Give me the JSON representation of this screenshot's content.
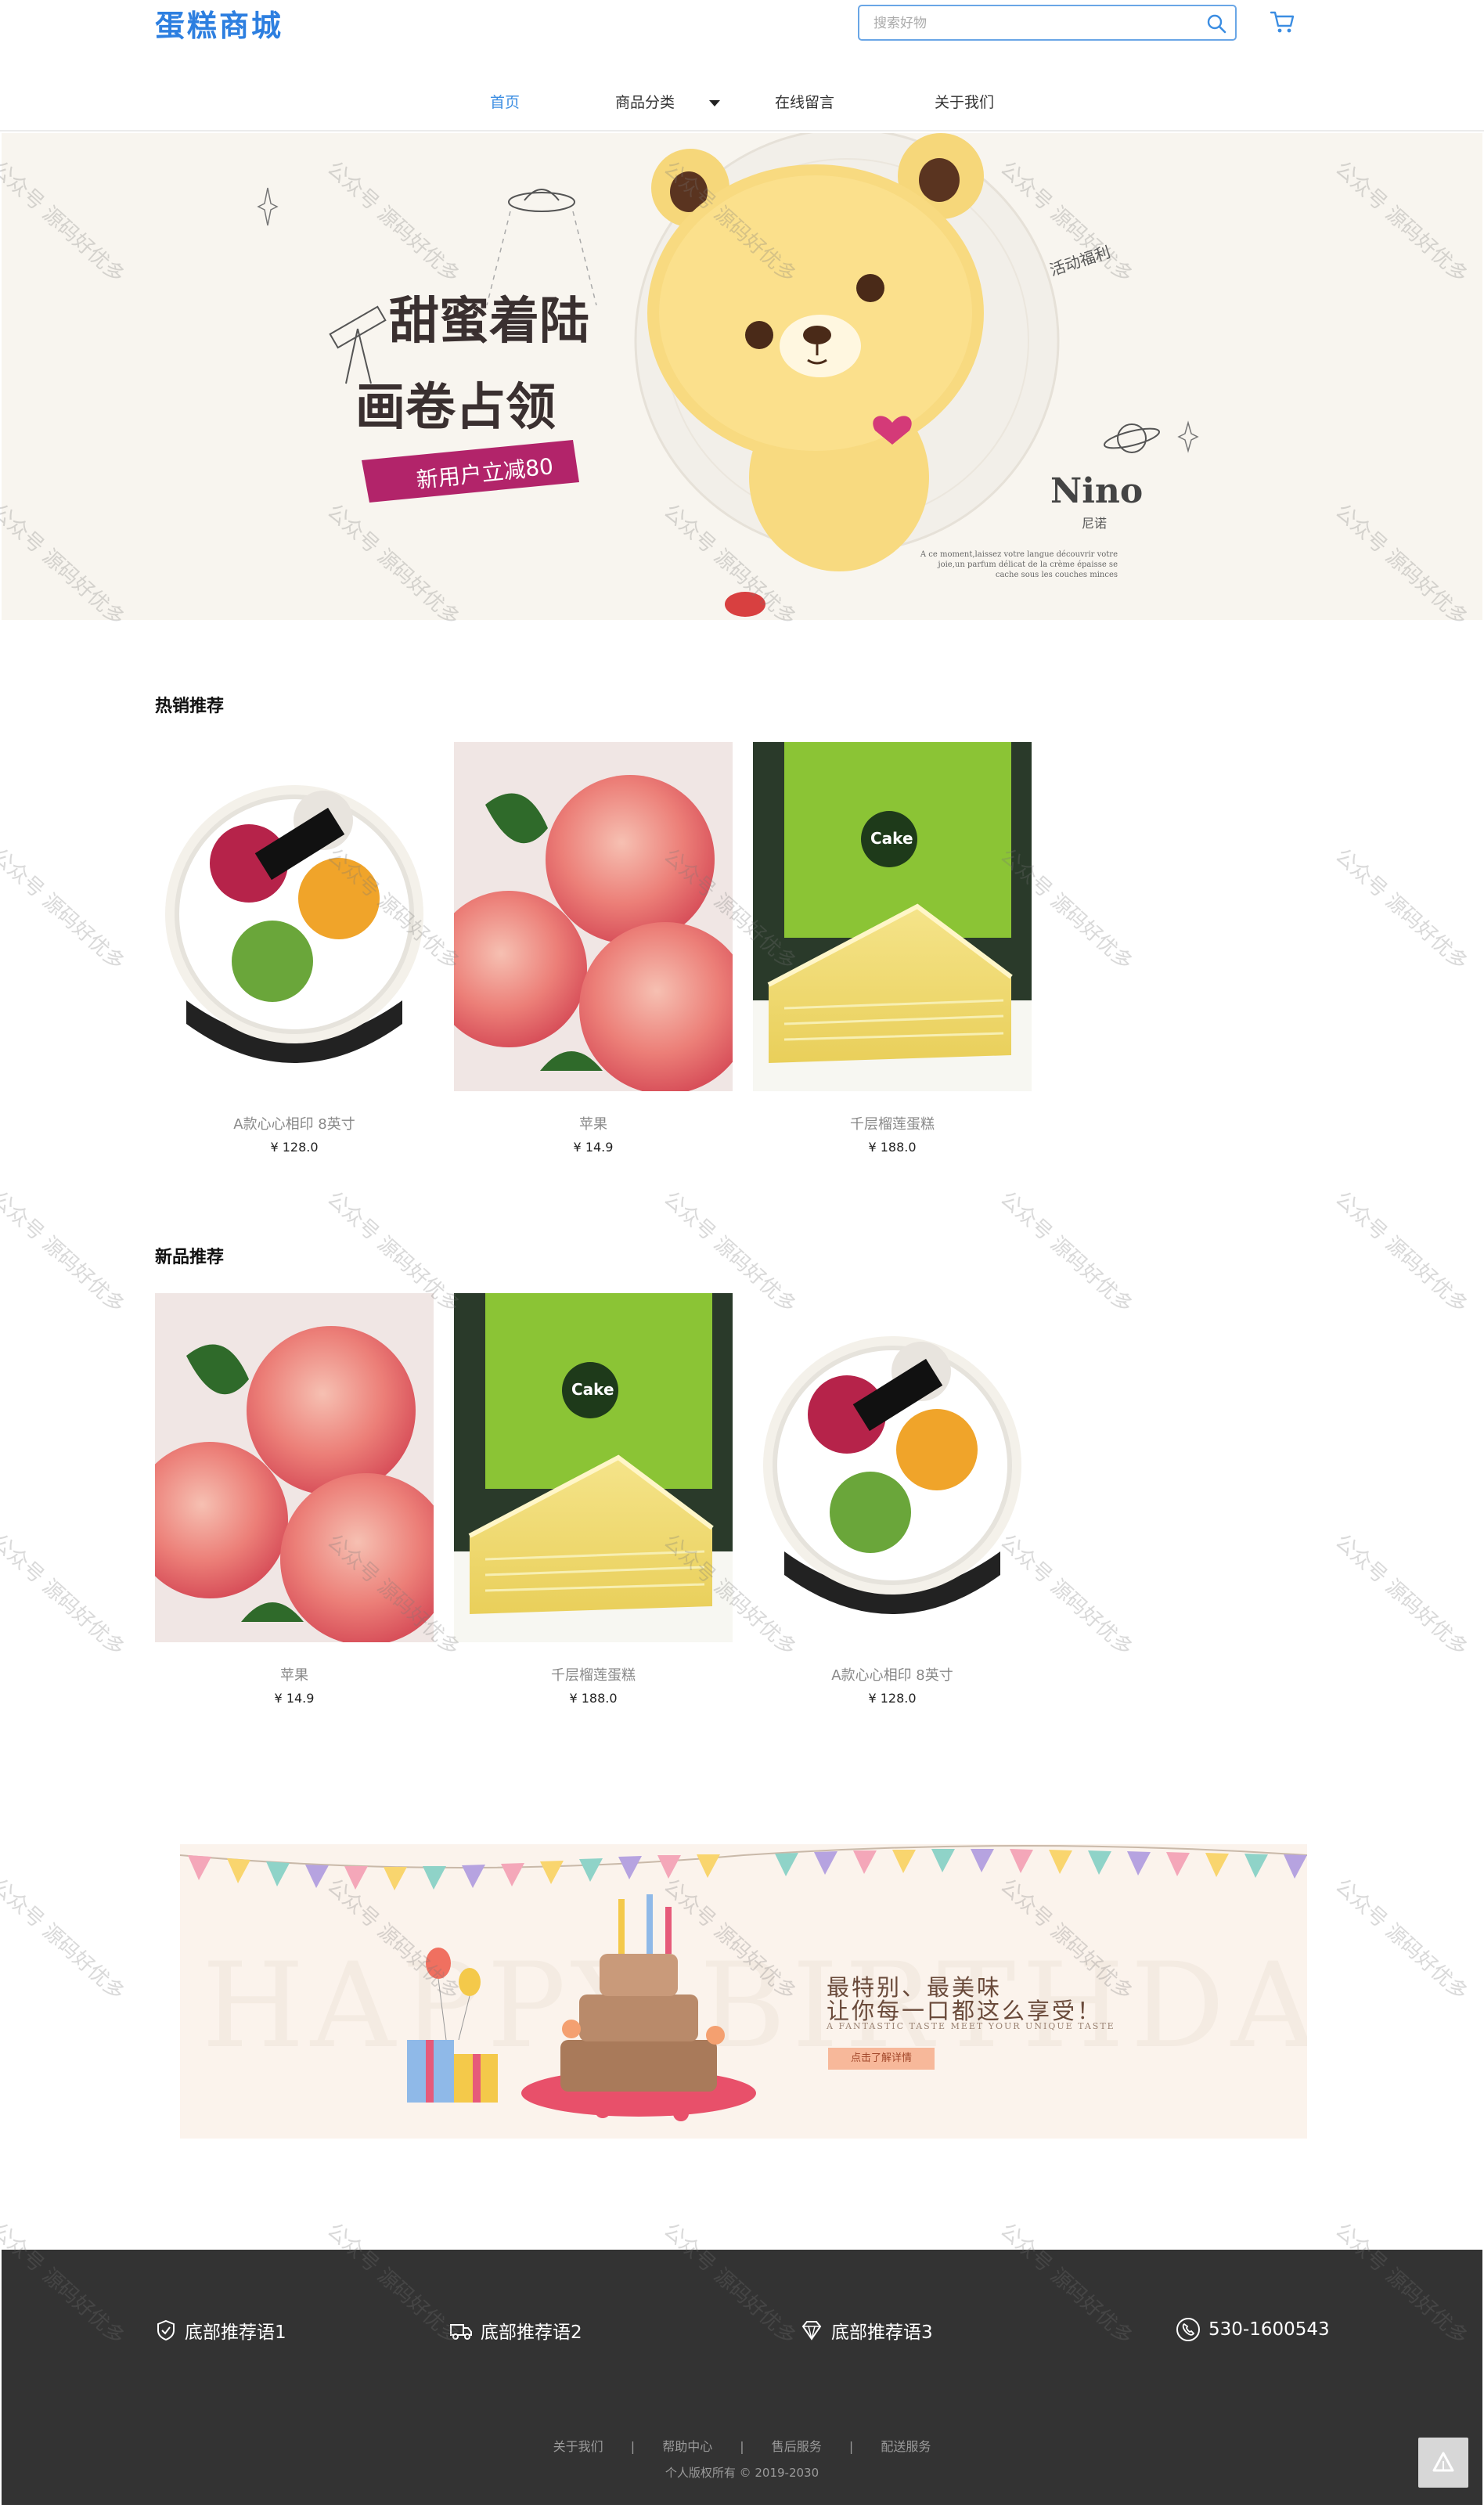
{
  "header": {
    "logo": "蛋糕商城",
    "search_placeholder": "搜索好物",
    "nav": [
      {
        "label": "首页",
        "active": true
      },
      {
        "label": "商品分类",
        "has_dropdown": true
      },
      {
        "label": "在线留言"
      },
      {
        "label": "关于我们"
      }
    ]
  },
  "banner": {
    "headline_1": "甜蜜着陆",
    "headline_2": "画卷占领",
    "promo": "新用户立减80",
    "brand": "Nino",
    "brand_cn": "尼诺",
    "tag": "活动福利",
    "caption": "A ce moment,laissez votre langue découvrir votre joie,un parfum délicat de la crème épaisse se cache sous les couches minces"
  },
  "hot": {
    "title": "热销推荐",
    "products": [
      {
        "name": "A款心心相印 8英寸",
        "price": "¥ 128.0",
        "image": "fruit-cake"
      },
      {
        "name": "苹果",
        "price": "¥ 14.9",
        "image": "apples"
      },
      {
        "name": "千层榴莲蛋糕",
        "price": "¥ 188.0",
        "image": "durian-crepe-cake"
      }
    ]
  },
  "new": {
    "title": "新品推荐",
    "products": [
      {
        "name": "苹果",
        "price": "¥ 14.9",
        "image": "apples"
      },
      {
        "name": "千层榴莲蛋糕",
        "price": "¥ 188.0",
        "image": "durian-crepe-cake"
      },
      {
        "name": "A款心心相印 8英寸",
        "price": "¥ 128.0",
        "image": "fruit-cake"
      }
    ]
  },
  "ad": {
    "title_line1": "最特别、最美味",
    "title_line2": "让你每一口都这么享受！",
    "subtitle": "A FANTASTIC TASTE MEET YOUR UNIQUE TASTE",
    "button": "点击了解详情",
    "background_text": "HAPPY BIRTHDAY"
  },
  "footer": {
    "features": [
      {
        "label": "底部推荐语1",
        "icon": "shield-check-icon"
      },
      {
        "label": "底部推荐语2",
        "icon": "delivery-truck-icon"
      },
      {
        "label": "底部推荐语3",
        "icon": "diamond-icon"
      },
      {
        "label": "530-1600543",
        "icon": "phone-icon"
      }
    ],
    "links": [
      "关于我们",
      "帮助中心",
      "售后服务",
      "配送服务"
    ],
    "separator": "|",
    "copyright": "个人版权所有 © 2019-2030"
  },
  "watermark": "公众号 源码好优多",
  "colors": {
    "brand_blue": "#2d7fe0",
    "footer_bg": "#333333",
    "banner_bg": "#f8f5ef"
  }
}
